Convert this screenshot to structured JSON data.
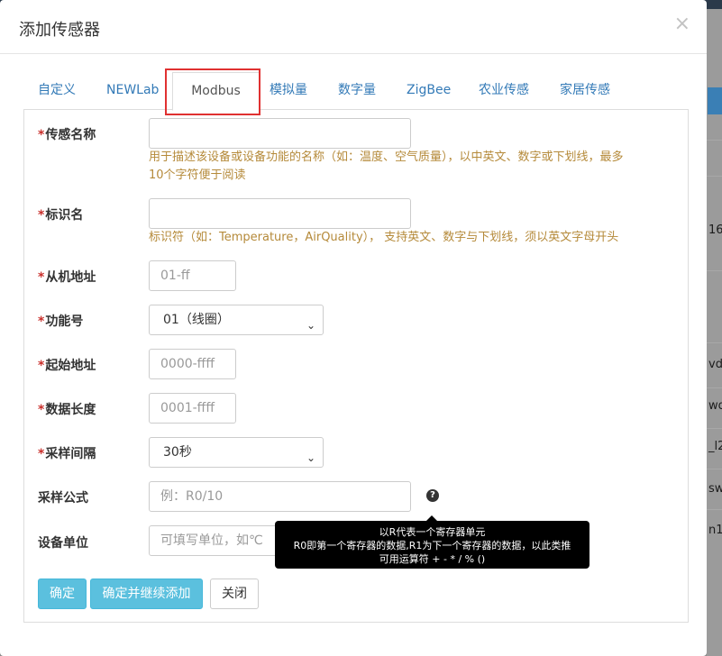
{
  "background": {
    "right_texts": [
      "16",
      "vd",
      "wd",
      "_l2",
      "sw",
      "n1"
    ]
  },
  "modal": {
    "title": "添加传感器",
    "close": "×"
  },
  "tabs": [
    "自定义",
    "NEWLab",
    "Modbus",
    "模拟量",
    "数字量",
    "ZigBee",
    "农业传感",
    "家居传感"
  ],
  "form": {
    "required_mark": "*",
    "sensor_name": {
      "label": "传感名称",
      "value": "",
      "help": [
        "用于描述该设备或设备功能的名称（如：温度、空气质量），以中英文、数字或下划线，最多",
        "10个字符便于阅读"
      ]
    },
    "identifier": {
      "label": "标识名",
      "value": "",
      "help": "标识符（如：Temperature，AirQuality）， 支持英文、数字与下划线，须以英文字母开头"
    },
    "slave_addr": {
      "label": "从机地址",
      "placeholder": "01-ff"
    },
    "function_code": {
      "label": "功能号",
      "selected": "01（线圈）"
    },
    "start_addr": {
      "label": "起始地址",
      "placeholder": "0000-ffff"
    },
    "data_length": {
      "label": "数据长度",
      "placeholder": "0001-ffff"
    },
    "sample_interval": {
      "label": "采样间隔",
      "selected": "30秒"
    },
    "sample_formula": {
      "label": "采样公式",
      "placeholder": "例：R0/10"
    },
    "device_unit": {
      "label": "设备单位",
      "placeholder": "可填写单位，如℃"
    }
  },
  "tooltip": {
    "lines": [
      "以R代表一个寄存器单元",
      "R0即第一个寄存器的数据,R1为下一个寄存器的数据，以此类推",
      "可用运算符 + - * / % ()"
    ]
  },
  "buttons": {
    "confirm": "确定",
    "confirm_continue": "确定并继续添加",
    "close": "关闭"
  }
}
